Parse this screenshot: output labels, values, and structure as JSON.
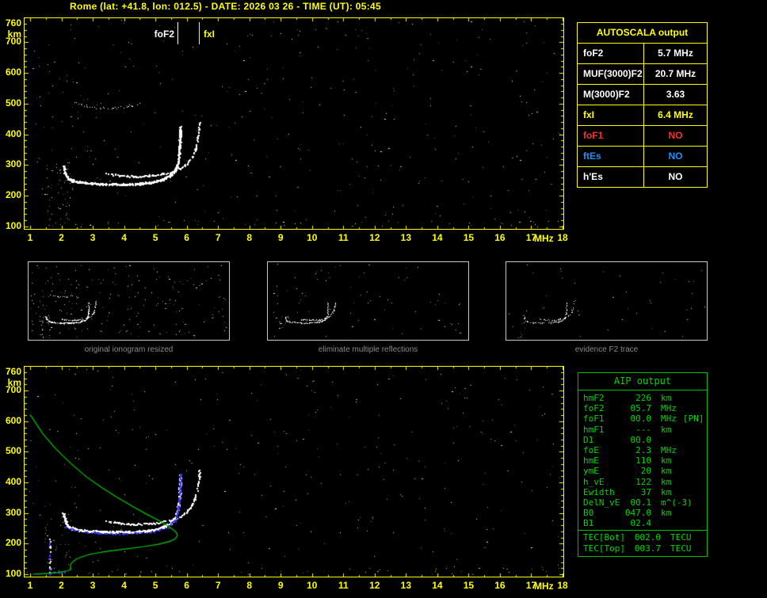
{
  "title": "Rome (lat: +41.8, lon: 012.5) - DATE: 2026 03 26 - TIME (UT): 05:45",
  "colors": {
    "axis": "#ffff00",
    "trace_white": "#ffffff",
    "restored_blue": "#3232ff",
    "profile_green": "#00cc00",
    "caption_gray": "#8a8a8a",
    "aip_green": "#00d800",
    "status_red": "#ff3030",
    "status_blue": "#2090ff"
  },
  "axes": {
    "y_ticks": [
      "760",
      "700",
      "600",
      "500",
      "400",
      "300",
      "200",
      "100"
    ],
    "y_unit": "km",
    "x_ticks": [
      "1",
      "2",
      "3",
      "4",
      "5",
      "6",
      "7",
      "8",
      "9",
      "10",
      "11",
      "12",
      "13",
      "14",
      "15",
      "16",
      "17",
      "18"
    ],
    "x_unit": "MHz"
  },
  "markers": {
    "fof2_label": "foF2",
    "fof2_freq": 5.7,
    "fxi_label": "fxI",
    "fxi_freq": 6.4
  },
  "autoscala": {
    "title": "AUTOSCALA output",
    "rows": [
      {
        "label": "foF2",
        "value": "5.7 MHz",
        "color": "#ffffff"
      },
      {
        "label": "MUF(3000)F2",
        "value": "20.7 MHz",
        "color": "#ffffff"
      },
      {
        "label": "M(3000)F2",
        "value": "3.63",
        "color": "#ffffff"
      },
      {
        "label": "fxI",
        "value": "6.4 MHz",
        "color": "#ffff00"
      },
      {
        "label": "foF1",
        "value": "NO",
        "color": "#ff3030"
      },
      {
        "label": "ftEs",
        "value": "NO",
        "color": "#2090ff"
      },
      {
        "label": "h'Es",
        "value": "NO",
        "color": "#ffffff"
      }
    ]
  },
  "thumbnails": [
    {
      "caption": "original ionogram resized"
    },
    {
      "caption": "eliminate multiple reflections"
    },
    {
      "caption": "evidence F2 trace"
    }
  ],
  "aip": {
    "title": "AIP output",
    "rows": [
      {
        "name": "hmF2",
        "value": "226",
        "unit": "km",
        "note": ""
      },
      {
        "name": "foF2",
        "value": "05.7",
        "unit": "MHz",
        "note": ""
      },
      {
        "name": "foF1",
        "value": "00.0",
        "unit": "MHz",
        "note": "[PN]"
      },
      {
        "name": "hmF1",
        "value": "---",
        "unit": "km",
        "note": ""
      },
      {
        "name": "D1",
        "value": "00.0",
        "unit": "",
        "note": ""
      },
      {
        "name": "foE",
        "value": "2.3",
        "unit": "MHz",
        "note": ""
      },
      {
        "name": "hmE",
        "value": "110",
        "unit": "km",
        "note": ""
      },
      {
        "name": "ymE",
        "value": "20",
        "unit": "km",
        "note": ""
      },
      {
        "name": "h_vE",
        "value": "122",
        "unit": "km",
        "note": ""
      },
      {
        "name": "Ewidth",
        "value": "37",
        "unit": "km",
        "note": ""
      },
      {
        "name": "DelN_vE",
        "value": "00.1",
        "unit": "m^(-3)",
        "note": ""
      },
      {
        "name": "B0",
        "value": "047.0",
        "unit": "km",
        "note": ""
      },
      {
        "name": "B1",
        "value": "02.4",
        "unit": "",
        "note": ""
      }
    ],
    "tec_rows": [
      {
        "name": "TEC[Bot]",
        "value": "002.0",
        "unit": "TECU"
      },
      {
        "name": "TEC[Top]",
        "value": "003.7",
        "unit": "TECU"
      }
    ]
  },
  "chart_data": [
    {
      "type": "scatter",
      "name": "ionogram",
      "title": "Rome ionogram 2026-03-26 05:45 UT",
      "xlabel": "MHz",
      "ylabel": "km",
      "xlim": [
        1,
        18
      ],
      "ylim": [
        100,
        760
      ],
      "grid": false,
      "annotations": {
        "foF2_MHz": 5.7,
        "fxI_MHz": 6.4,
        "MUF3000F2_MHz": 20.7,
        "M3000F2": 3.63
      },
      "series": [
        {
          "name": "F2 trace O-mode",
          "color": "#ffffff",
          "points": [
            [
              2.05,
              300
            ],
            [
              2.1,
              276
            ],
            [
              2.2,
              258
            ],
            [
              2.35,
              250
            ],
            [
              2.6,
              245
            ],
            [
              2.9,
              242
            ],
            [
              3.3,
              240
            ],
            [
              3.7,
              239
            ],
            [
              4.1,
              239
            ],
            [
              4.5,
              241
            ],
            [
              4.8,
              244
            ],
            [
              5.05,
              249
            ],
            [
              5.25,
              256
            ],
            [
              5.45,
              266
            ],
            [
              5.6,
              281
            ],
            [
              5.68,
              300
            ],
            [
              5.73,
              325
            ],
            [
              5.76,
              360
            ],
            [
              5.78,
              400
            ],
            [
              5.79,
              428
            ]
          ]
        },
        {
          "name": "F2 trace X-mode",
          "color": "#ffffff",
          "points": [
            [
              3.4,
              274
            ],
            [
              3.8,
              268
            ],
            [
              4.2,
              265
            ],
            [
              4.6,
              265
            ],
            [
              4.95,
              268
            ],
            [
              5.25,
              273
            ],
            [
              5.55,
              281
            ],
            [
              5.8,
              292
            ],
            [
              6.0,
              307
            ],
            [
              6.15,
              327
            ],
            [
              6.27,
              355
            ],
            [
              6.34,
              390
            ],
            [
              6.38,
              420
            ],
            [
              6.4,
              442
            ]
          ]
        },
        {
          "name": "second hop echo",
          "color": "#ffffff",
          "points": [
            [
              2.35,
              510
            ],
            [
              2.7,
              495
            ],
            [
              3.1,
              487
            ],
            [
              3.5,
              485
            ],
            [
              3.9,
              488
            ],
            [
              4.3,
              495
            ],
            [
              4.6,
              506
            ]
          ]
        }
      ]
    },
    {
      "type": "line",
      "name": "restored ionogram and electron density profile",
      "xlim": [
        1,
        18
      ],
      "ylim": [
        100,
        760
      ],
      "grid": false,
      "series": [
        {
          "name": "electron density profile",
          "color": "#00cc00",
          "points": [
            [
              1.0,
              622
            ],
            [
              1.4,
              560
            ],
            [
              1.8,
              512
            ],
            [
              2.3,
              462
            ],
            [
              2.8,
              418
            ],
            [
              3.3,
              382
            ],
            [
              3.8,
              350
            ],
            [
              4.3,
              320
            ],
            [
              4.7,
              297
            ],
            [
              5.1,
              276
            ],
            [
              5.4,
              258
            ],
            [
              5.6,
              243
            ],
            [
              5.69,
              233
            ],
            [
              5.7,
              226
            ],
            [
              5.63,
              216
            ],
            [
              5.45,
              207
            ],
            [
              5.1,
              198
            ],
            [
              4.6,
              190
            ],
            [
              4.0,
              182
            ],
            [
              3.4,
              174
            ],
            [
              2.95,
              166
            ],
            [
              2.65,
              157
            ],
            [
              2.45,
              148
            ],
            [
              2.35,
              140
            ],
            [
              2.3,
              132
            ],
            [
              2.28,
              124
            ],
            [
              2.31,
              119
            ],
            [
              2.27,
              114
            ],
            [
              2.18,
              111
            ],
            [
              2.02,
              108
            ],
            [
              1.85,
              105
            ],
            [
              1.6,
              103
            ],
            [
              1.28,
              101
            ],
            [
              1.08,
              100
            ]
          ]
        },
        {
          "name": "restored trace",
          "color": "#3232ff",
          "points": [
            [
              2.1,
              262
            ],
            [
              2.4,
              250
            ],
            [
              2.8,
              244
            ],
            [
              3.2,
              241
            ],
            [
              3.7,
              239
            ],
            [
              4.2,
              240
            ],
            [
              4.7,
              243
            ],
            [
              5.1,
              250
            ],
            [
              5.4,
              261
            ],
            [
              5.6,
              278
            ],
            [
              5.7,
              305
            ],
            [
              5.75,
              350
            ],
            [
              5.78,
              400
            ],
            [
              5.79,
              430
            ]
          ]
        }
      ]
    }
  ]
}
